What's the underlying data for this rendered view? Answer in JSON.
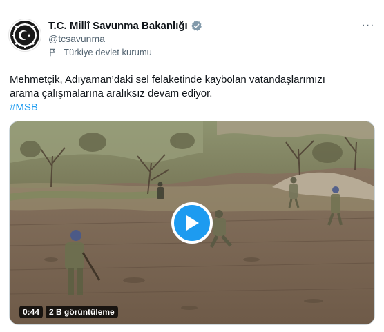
{
  "account": {
    "display_name": "T.C. Millî Savunma Bakanlığı",
    "handle": "@tcsavunma",
    "label": "Türkiye devlet kurumu",
    "verified_icon": "verified-badge-icon",
    "verified_color": "#829aab"
  },
  "actions": {
    "more_label": "···"
  },
  "tweet": {
    "line1": "Mehmetçik, Adıyaman’daki sel felaketinde kaybolan vatandaşlarımızı",
    "line2": "arama çalışmalarına aralıksız devam ediyor.",
    "hashtag": "#MSB"
  },
  "video": {
    "duration": "0:44",
    "views": "2 B görüntüleme",
    "play_icon": "play-icon",
    "accent": "#1d9bf0"
  },
  "colors": {
    "text": "#0f1419",
    "secondary": "#536471",
    "link": "#1d9bf0"
  }
}
